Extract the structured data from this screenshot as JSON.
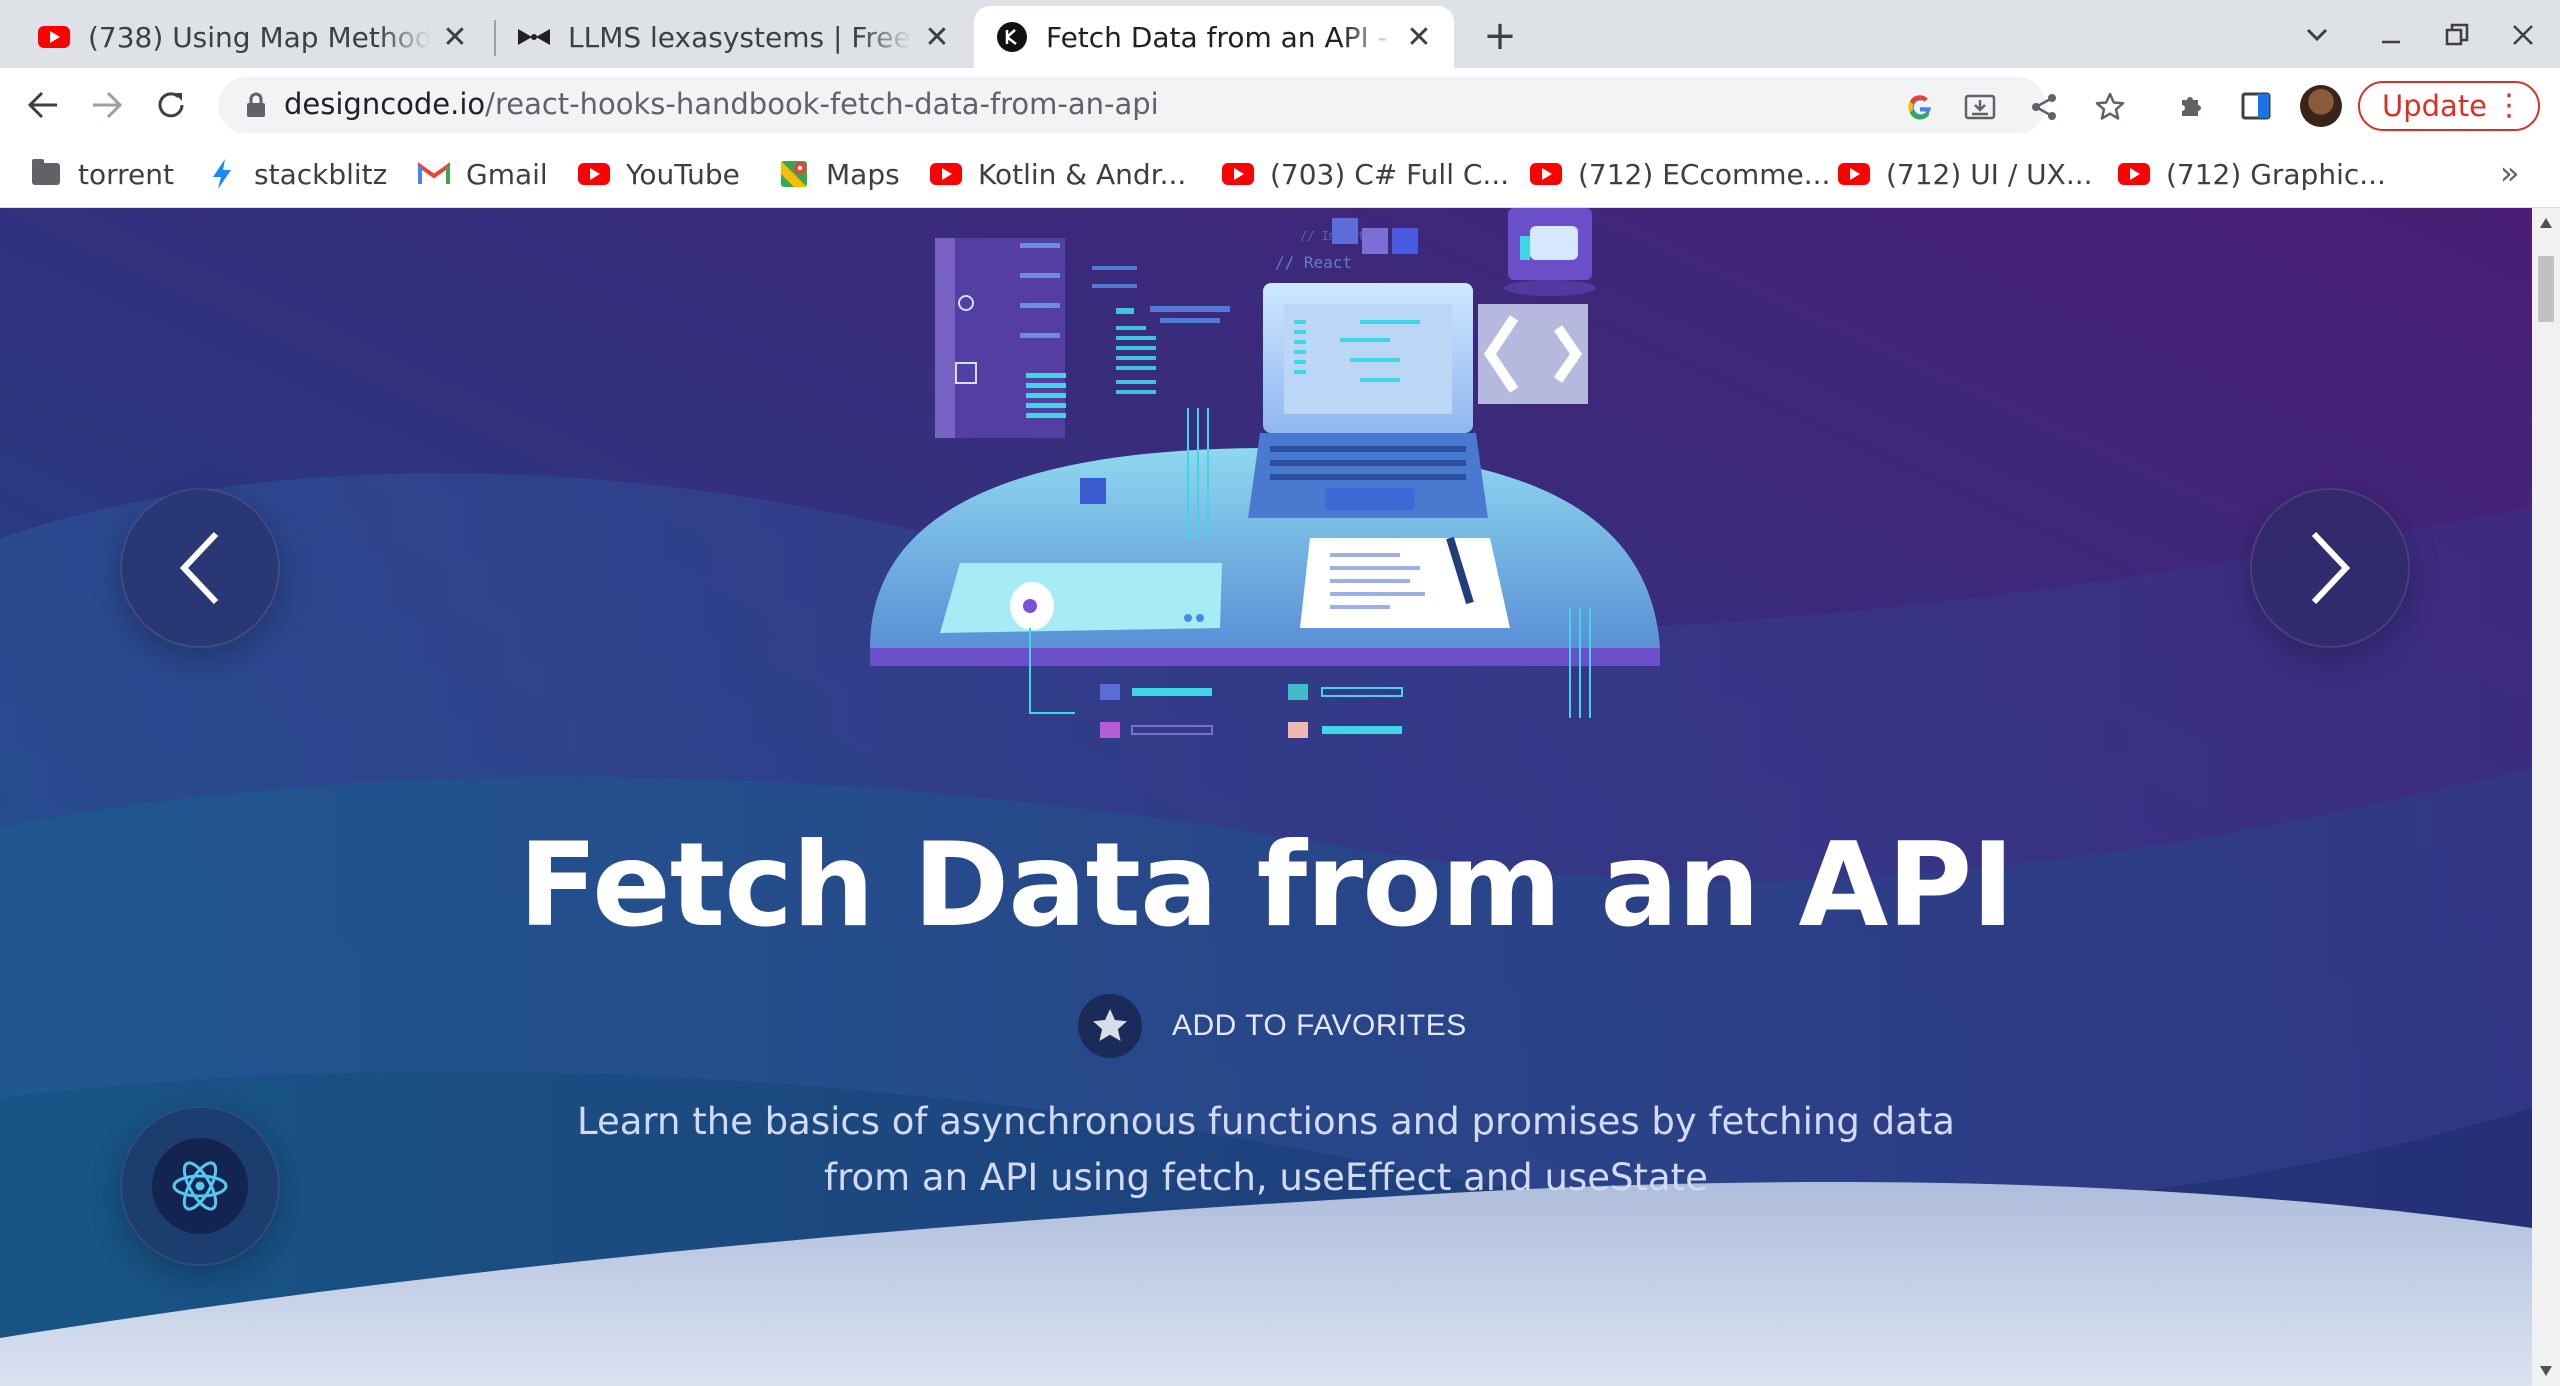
{
  "browser": {
    "tabs": [
      {
        "title": "(738) Using Map Method in",
        "favicon": "youtube-icon",
        "active": false
      },
      {
        "title": "LLMS lexasystems | Free an",
        "favicon": "bowtie-icon",
        "active": false
      },
      {
        "title": "Fetch Data from an API - R",
        "favicon": "designcode-icon",
        "active": true
      }
    ],
    "close_glyph": "✕",
    "new_tab_glyph": "+",
    "url_host": "designcode.io",
    "url_path": "/react-hooks-handbook-fetch-data-from-an-api",
    "update_label": "Update",
    "update_menu_glyph": "⋮",
    "bookmarks": [
      {
        "label": "torrent",
        "icon": "folder-icon"
      },
      {
        "label": "stackblitz",
        "icon": "lightning-icon"
      },
      {
        "label": "Gmail",
        "icon": "gmail-icon"
      },
      {
        "label": "YouTube",
        "icon": "youtube-icon"
      },
      {
        "label": "Maps",
        "icon": "maps-icon"
      },
      {
        "label": "Kotlin & Andr...",
        "icon": "youtube-icon"
      },
      {
        "label": "(703) C# Full C...",
        "icon": "youtube-icon"
      },
      {
        "label": "(712) ECcomme...",
        "icon": "youtube-icon"
      },
      {
        "label": "(712) UI / UX...",
        "icon": "youtube-icon"
      },
      {
        "label": "(712) Graphic...",
        "icon": "youtube-icon"
      }
    ],
    "bookmarks_overflow": "»"
  },
  "page": {
    "title": "Fetch Data from an API",
    "favorites_label": "ADD TO FAVORITES",
    "description_line1": "Learn the basics of asynchronous functions and promises by fetching data",
    "description_line2": "from an API using fetch, useEffect and useState",
    "illustration_code_comment": "// React"
  },
  "colors": {
    "hero_top_right": "#4a1f78",
    "hero_mid": "#31307e",
    "hero_bottom_left": "#1a4f83",
    "title": "#ffffff",
    "accent_cyan": "#3fd6e6",
    "update_red": "#d93025"
  }
}
